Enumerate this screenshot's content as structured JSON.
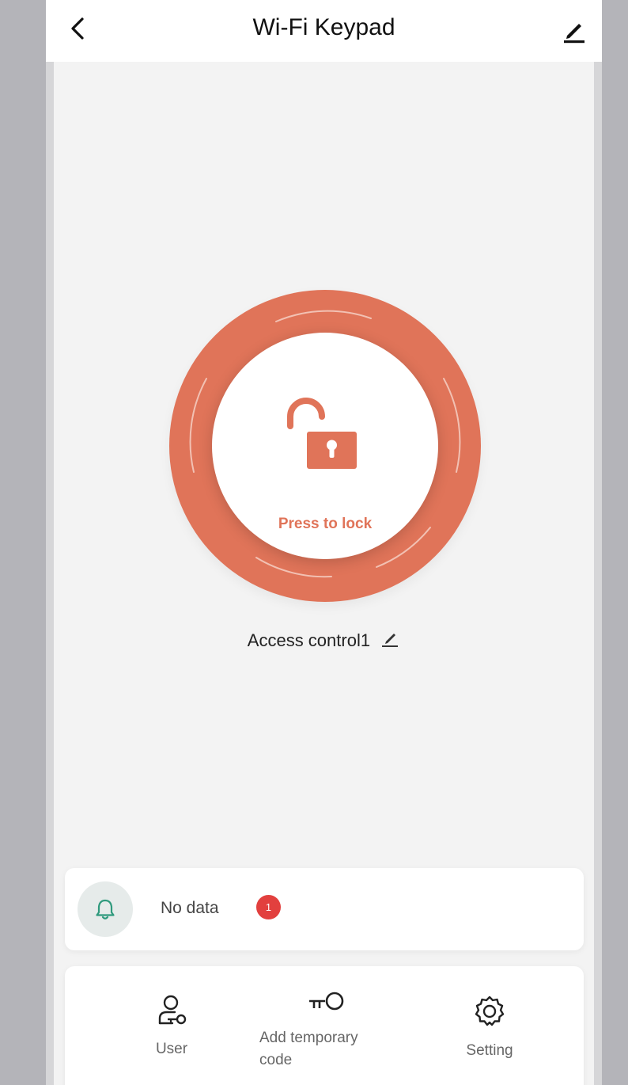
{
  "header": {
    "back_icon": "chevron-left-icon",
    "title": "Wi-Fi Keypad",
    "edit_icon": "pencil-icon"
  },
  "lock_control": {
    "state_icon": "unlocked-padlock-icon",
    "action_label": "Press to lock",
    "ring_color": "#e07459"
  },
  "device": {
    "name": "Access control1",
    "rename_icon": "pencil-icon"
  },
  "notification": {
    "icon": "bell-icon",
    "text": "No data",
    "badge_count": "1",
    "badge_color": "#e2403e"
  },
  "bottom_nav": {
    "items": [
      {
        "label": "User",
        "icon": "user-key-icon"
      },
      {
        "label": "Add temporary code",
        "icon": "key-icon"
      },
      {
        "label": "Setting",
        "icon": "gear-icon"
      }
    ]
  }
}
